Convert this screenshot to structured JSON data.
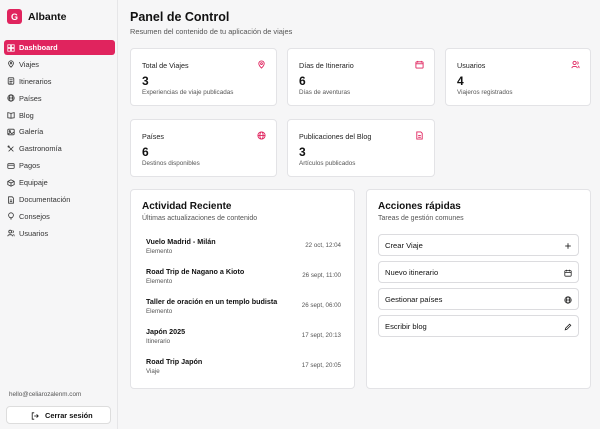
{
  "brand": {
    "logo_letter": "G",
    "name": "Albante"
  },
  "nav": [
    {
      "label": "Dashboard",
      "icon": "dashboard-icon",
      "active": true
    },
    {
      "label": "Viajes",
      "icon": "map-pin-icon"
    },
    {
      "label": "Itinerarios",
      "icon": "list-icon"
    },
    {
      "label": "Países",
      "icon": "globe-icon"
    },
    {
      "label": "Blog",
      "icon": "book-icon"
    },
    {
      "label": "Galería",
      "icon": "image-icon"
    },
    {
      "label": "Gastronomía",
      "icon": "utensils-icon"
    },
    {
      "label": "Pagos",
      "icon": "credit-card-icon"
    },
    {
      "label": "Equipaje",
      "icon": "package-icon"
    },
    {
      "label": "Documentación",
      "icon": "document-icon"
    },
    {
      "label": "Consejos",
      "icon": "lightbulb-icon"
    },
    {
      "label": "Usuarios",
      "icon": "users-icon"
    }
  ],
  "footer": {
    "email": "hello@celiarozalenm.com",
    "logout_label": "Cerrar sesión"
  },
  "header": {
    "title": "Panel de Control",
    "subtitle": "Resumen del contenido de tu aplicación de viajes"
  },
  "stats": [
    {
      "label": "Total de Viajes",
      "value": "3",
      "desc": "Experiencias de viaje publicadas",
      "icon": "map-pin-icon"
    },
    {
      "label": "Días de Itinerario",
      "value": "6",
      "desc": "Días de aventuras",
      "icon": "calendar-icon"
    },
    {
      "label": "Usuarios",
      "value": "4",
      "desc": "Viajeros registrados",
      "icon": "users-icon"
    },
    {
      "label": "Países",
      "value": "6",
      "desc": "Destinos disponibles",
      "icon": "globe-icon"
    },
    {
      "label": "Publicaciones del Blog",
      "value": "3",
      "desc": "Artículos publicados",
      "icon": "document-icon"
    }
  ],
  "activity": {
    "title": "Actividad Reciente",
    "subtitle": "Últimas actualizaciones de contenido",
    "items": [
      {
        "title": "Vuelo Madrid - Milán",
        "type": "Elemento",
        "time": "22 oct, 12:04"
      },
      {
        "title": "Road Trip de Nagano a Kioto",
        "type": "Elemento",
        "time": "26 sept, 11:00"
      },
      {
        "title": "Taller de oración en un templo budista",
        "type": "Elemento",
        "time": "26 sept, 06:00"
      },
      {
        "title": "Japón 2025",
        "type": "Itinerario",
        "time": "17 sept, 20:13"
      },
      {
        "title": "Road Trip Japón",
        "type": "Viaje",
        "time": "17 sept, 20:05"
      }
    ]
  },
  "quick_actions": {
    "title": "Acciones rápidas",
    "subtitle": "Tareas de gestión comunes",
    "items": [
      {
        "label": "Crear Viaje",
        "icon": "plus-icon"
      },
      {
        "label": "Nuevo itinerario",
        "icon": "calendar-icon"
      },
      {
        "label": "Gestionar países",
        "icon": "globe-icon"
      },
      {
        "label": "Escribir blog",
        "icon": "pencil-icon"
      }
    ]
  },
  "colors": {
    "accent": "#e0245e",
    "background": "#f6f6f7",
    "card": "#ffffff"
  }
}
